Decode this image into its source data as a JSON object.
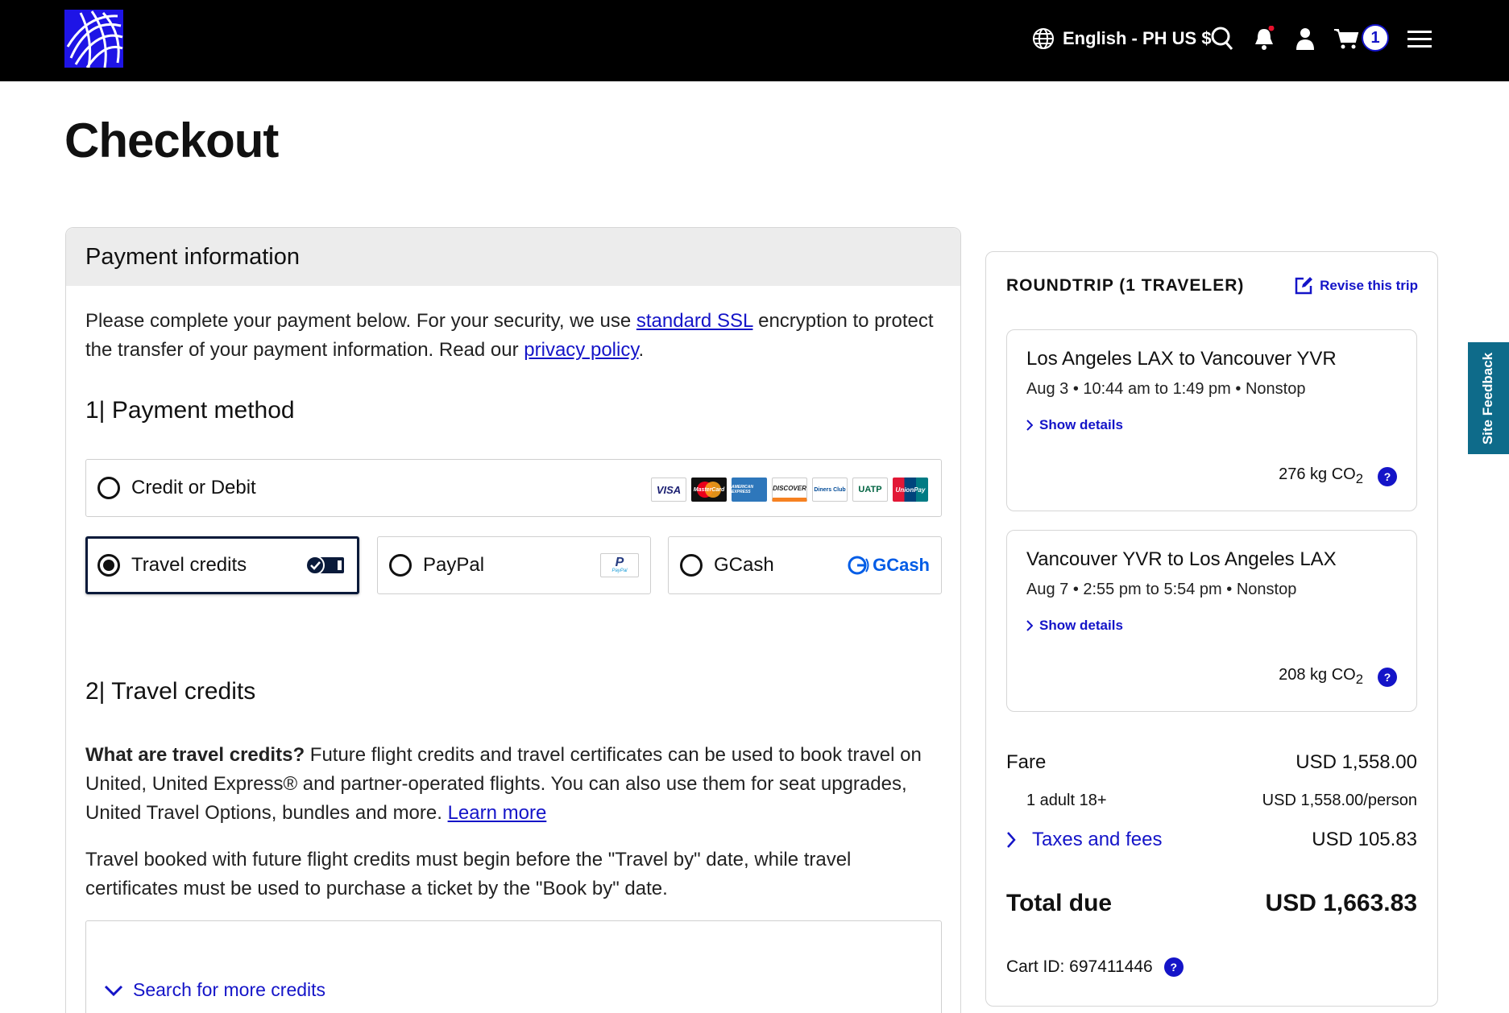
{
  "header": {
    "logo_icon": "united-globe-logo",
    "language": "English - PH US $",
    "cart_count": "1"
  },
  "page": {
    "title": "Checkout"
  },
  "payment": {
    "heading": "Payment information",
    "intro_before": "Please complete your payment below. For your security, we use ",
    "ssl_link": "standard SSL",
    "intro_middle": " encryption to protect the transfer of your payment information. Read our ",
    "privacy_link": "privacy policy",
    "intro_end": ".",
    "method_heading": "1| Payment method",
    "methods": {
      "credit": "Credit or Debit",
      "travel": "Travel credits",
      "paypal": "PayPal",
      "gcash": "GCash"
    },
    "card_logos": [
      "VISA",
      "MasterCard",
      "AMERICAN EXPRESS",
      "DISCOVER",
      "Diners Club",
      "UATP",
      "UnionPay"
    ],
    "paypal_logo": "PayPal",
    "gcash_logo": "GCash",
    "credits_heading": "2| Travel credits",
    "what_bold": "What are travel credits?",
    "what_text": " Future flight credits and travel certificates can be used to book travel on United, United Express® and partner-operated flights. You can also use them for seat upgrades, United Travel Options, bundles and more. ",
    "learn_more": "Learn more",
    "travel_by_text": "Travel booked with future flight credits must begin before the \"Travel by\" date, while travel certificates must be used to purchase a ticket by the \"Book by\" date.",
    "search_more": "Search for more credits"
  },
  "summary": {
    "heading": "ROUNDTRIP (1 TRAVELER)",
    "revise": "Revise this trip",
    "segments": [
      {
        "route": "Los Angeles LAX to Vancouver YVR",
        "times": "Aug 3 • 10:44 am to 1:49 pm • Nonstop",
        "show": "Show details",
        "co2_value": "276 kg CO",
        "co2_sub": "2"
      },
      {
        "route": "Vancouver YVR to Los Angeles LAX",
        "times": "Aug 7 • 2:55 pm to 5:54 pm • Nonstop",
        "show": "Show details",
        "co2_value": "208 kg CO",
        "co2_sub": "2"
      }
    ],
    "fare_label": "Fare",
    "fare_value": "USD 1,558.00",
    "adult_label": "1 adult 18+",
    "adult_value": "USD 1,558.00/person",
    "taxes_label": "Taxes and fees",
    "taxes_value": "USD 105.83",
    "total_label": "Total due",
    "total_value": "USD 1,663.83",
    "cart_id": "Cart ID: 697411446"
  },
  "side_tab": "Site Feedback",
  "colors": {
    "brand_blue": "#1414c8",
    "header_bg": "#000000",
    "feedback_tab": "#0e6b8a"
  }
}
